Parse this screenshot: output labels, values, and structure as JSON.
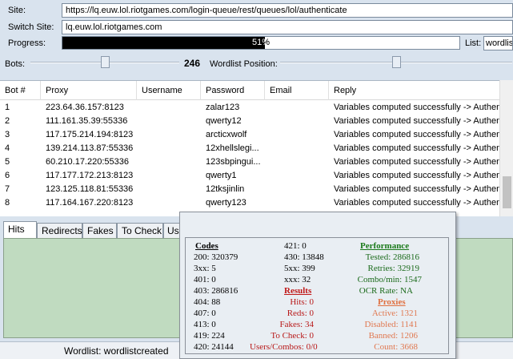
{
  "top": {
    "site_label": "Site:",
    "site_value": "https://lq.euw.lol.riotgames.com/login-queue/rest/queues/lol/authenticate",
    "switch_label": "Switch Site:",
    "switch_value": "lq.euw.lol.riotgames.com",
    "progress_label": "Progress:",
    "progress_text": "51%",
    "progress_fraction": 0.51,
    "list_label": "List:",
    "list_value": "wordlist",
    "bots_label": "Bots:",
    "bots_value": "246",
    "wordlist_position_label": "Wordlist Position:"
  },
  "grid": {
    "columns": [
      "Bot #",
      "Proxy",
      "Username",
      "Password",
      "Email",
      "Reply"
    ],
    "rows": [
      {
        "bot": "1",
        "proxy": "223.64.36.157:8123",
        "username": "",
        "password": "zalar123",
        "email": "",
        "reply": "Variables computed successfully -> Authenticati"
      },
      {
        "bot": "2",
        "proxy": "111.161.35.39:55336",
        "username": "",
        "password": "qwerty12",
        "email": "",
        "reply": "Variables computed successfully -> Authenticati"
      },
      {
        "bot": "3",
        "proxy": "117.175.214.194:8123",
        "username": "",
        "password": "arcticxwolf",
        "email": "",
        "reply": "Variables computed successfully -> Authenticati"
      },
      {
        "bot": "4",
        "proxy": "139.214.113.87:55336",
        "username": "",
        "password": "12xhellslegi...",
        "email": "",
        "reply": "Variables computed successfully -> Authenticati"
      },
      {
        "bot": "5",
        "proxy": "60.210.17.220:55336",
        "username": "",
        "password": "123sbpingui...",
        "email": "",
        "reply": "Variables computed successfully -> Authenticati"
      },
      {
        "bot": "6",
        "proxy": "117.177.172.213:8123",
        "username": "",
        "password": "qwerty1",
        "email": "",
        "reply": "Variables computed successfully -> Authenticati"
      },
      {
        "bot": "7",
        "proxy": "123.125.118.81:55336",
        "username": "",
        "password": "12tksjinlin",
        "email": "",
        "reply": "Variables computed successfully -> Authenticati"
      },
      {
        "bot": "8",
        "proxy": "117.164.167.220:8123",
        "username": "",
        "password": "qwerty123",
        "email": "",
        "reply": "Variables computed successfully -> Authenticati"
      }
    ]
  },
  "tabs": [
    "Hits",
    "Redirects",
    "Fakes",
    "To Check",
    "Us"
  ],
  "status": {
    "wordlist_text": "Wordlist: wordlistcreated"
  },
  "stats": {
    "codes_header": "Codes",
    "codes": [
      "200: 320379",
      "3xx: 5",
      "401: 0",
      "403: 286816",
      "404: 88",
      "407: 0",
      "413: 0",
      "419: 224",
      "420: 24144"
    ],
    "codes2": [
      "421: 0",
      "430: 13848",
      "5xx: 399",
      "xxx: 32"
    ],
    "results_header": "Results",
    "results": [
      "Hits: 0",
      "Reds: 0",
      "Fakes: 34",
      "To Check: 0",
      "Users/Combos: 0/0"
    ],
    "performance_header": "Performance",
    "performance": [
      "Tested: 286816",
      "Retries: 32919",
      "Combo/min: 1547",
      "OCR Rate: NA"
    ],
    "proxies_header": "Proxies",
    "proxies": [
      "Active: 1321",
      "Disabled: 1141",
      "Banned: 1206",
      "Count: 3668"
    ]
  },
  "colors": {
    "background": "#d9e3ee",
    "panel_green": "#c0dbc0",
    "progress_fill": "#000000"
  }
}
